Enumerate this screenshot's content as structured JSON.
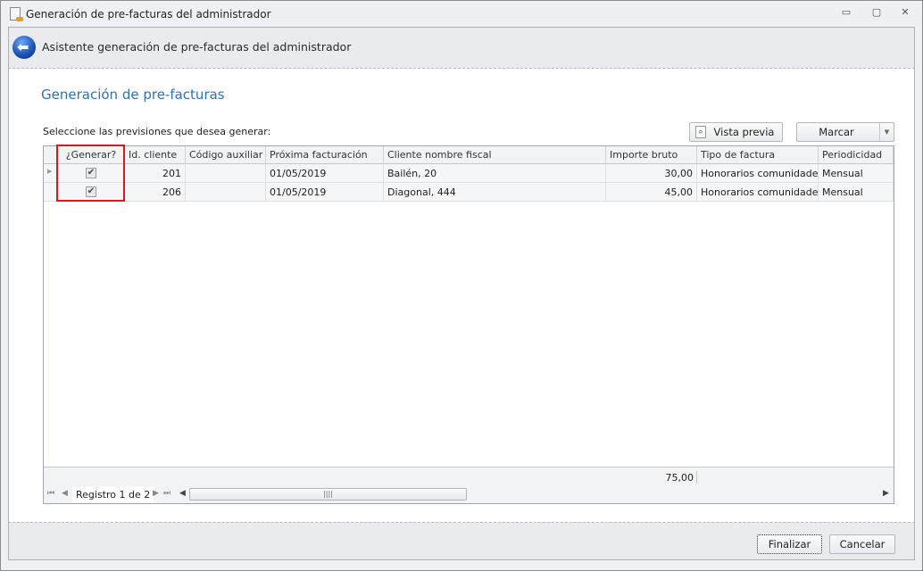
{
  "window": {
    "title": "Generación de pre-facturas del administrador",
    "minimize": "▭",
    "restore": "▢",
    "close": "✕"
  },
  "header": {
    "title": "Asistente generación de pre-facturas del administrador"
  },
  "page": {
    "title": "Generación de pre-facturas",
    "prompt": "Seleccione las previsiones que desea generar:"
  },
  "toolbar": {
    "preview_label": "Vista previa",
    "mark_label": "Marcar"
  },
  "grid": {
    "columns": [
      "¿Generar?",
      "Id. cliente",
      "Código auxiliar",
      "Próxima facturación",
      "Cliente nombre fiscal",
      "Importe bruto",
      "Tipo de factura",
      "Periodicidad"
    ],
    "rows": [
      {
        "generar": true,
        "id": "201",
        "codigo": "",
        "proxima": "01/05/2019",
        "cliente": "Bailén, 20",
        "importe": "30,00",
        "tipo": "Honorarios comunidades",
        "periodicidad": "Mensual"
      },
      {
        "generar": true,
        "id": "206",
        "codigo": "",
        "proxima": "01/05/2019",
        "cliente": "Diagonal, 444",
        "importe": "45,00",
        "tipo": "Honorarios comunidades",
        "periodicidad": "Mensual"
      }
    ],
    "total_importe": "75,00",
    "record_nav": "Registro 1 de 2"
  },
  "footer": {
    "finish_label": "Finalizar",
    "cancel_label": "Cancelar"
  }
}
